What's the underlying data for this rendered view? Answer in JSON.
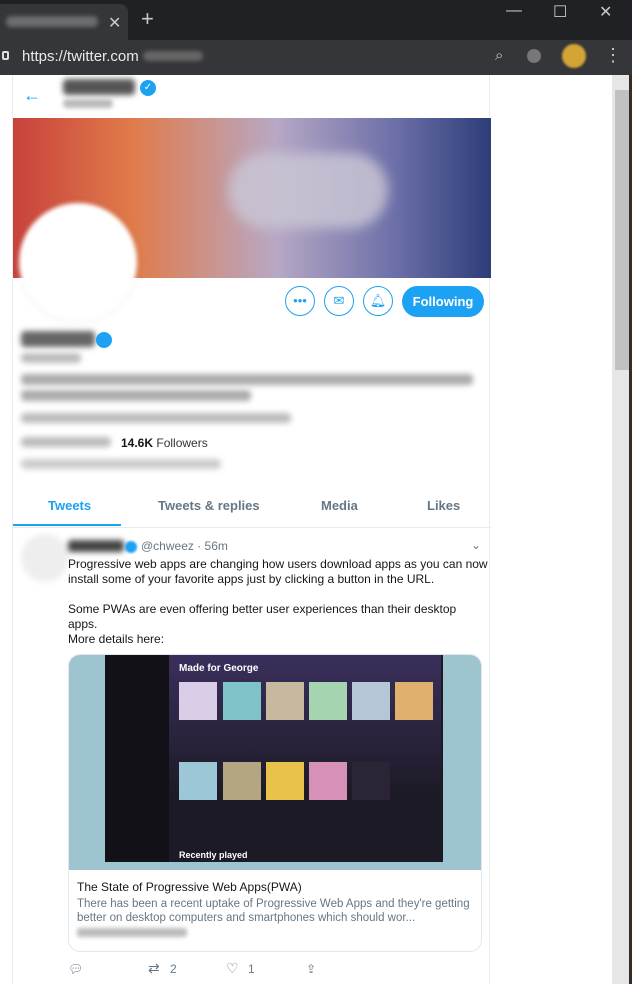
{
  "browser": {
    "url": "https://twitter.com",
    "new_tab": "+",
    "tab_close": "✕",
    "win_min": "—",
    "win_max": "☐",
    "win_close": "✕",
    "menu": "⋮"
  },
  "profile": {
    "back": "←",
    "verified_mark": "✓",
    "followers_count": "14.6K",
    "followers_label": "Followers",
    "following_label": "Following",
    "follow_button": "Following",
    "dots_icon": "•••",
    "mail_icon": "✉",
    "bell_icon": "🔔︎"
  },
  "tabs": [
    "Tweets",
    "Tweets & replies",
    "Media",
    "Likes"
  ],
  "tweet": {
    "handle_time": "@chweez · 56m",
    "chevron": "⌄",
    "text_line1": "Progressive web apps are changing how users download apps as you can now",
    "text_line2": "install some of your favorite apps just by clicking a button in the URL.",
    "text_para2": "Some PWAs are even offering better user experiences than their desktop apps.",
    "text_para3": "More details here:",
    "card": {
      "header": "Made for George",
      "recent": "Recently played",
      "title": "The State of Progressive Web Apps(PWA)",
      "description": "There has been a recent uptake of Progressive Web Apps and they're getting better on desktop computers and smartphones which should wor..."
    },
    "actions": {
      "reply_icon": "💬︎",
      "retweet_icon": "⇄",
      "retweet_count": "2",
      "like_icon": "♡",
      "like_count": "1",
      "share_icon": "⇪"
    }
  }
}
